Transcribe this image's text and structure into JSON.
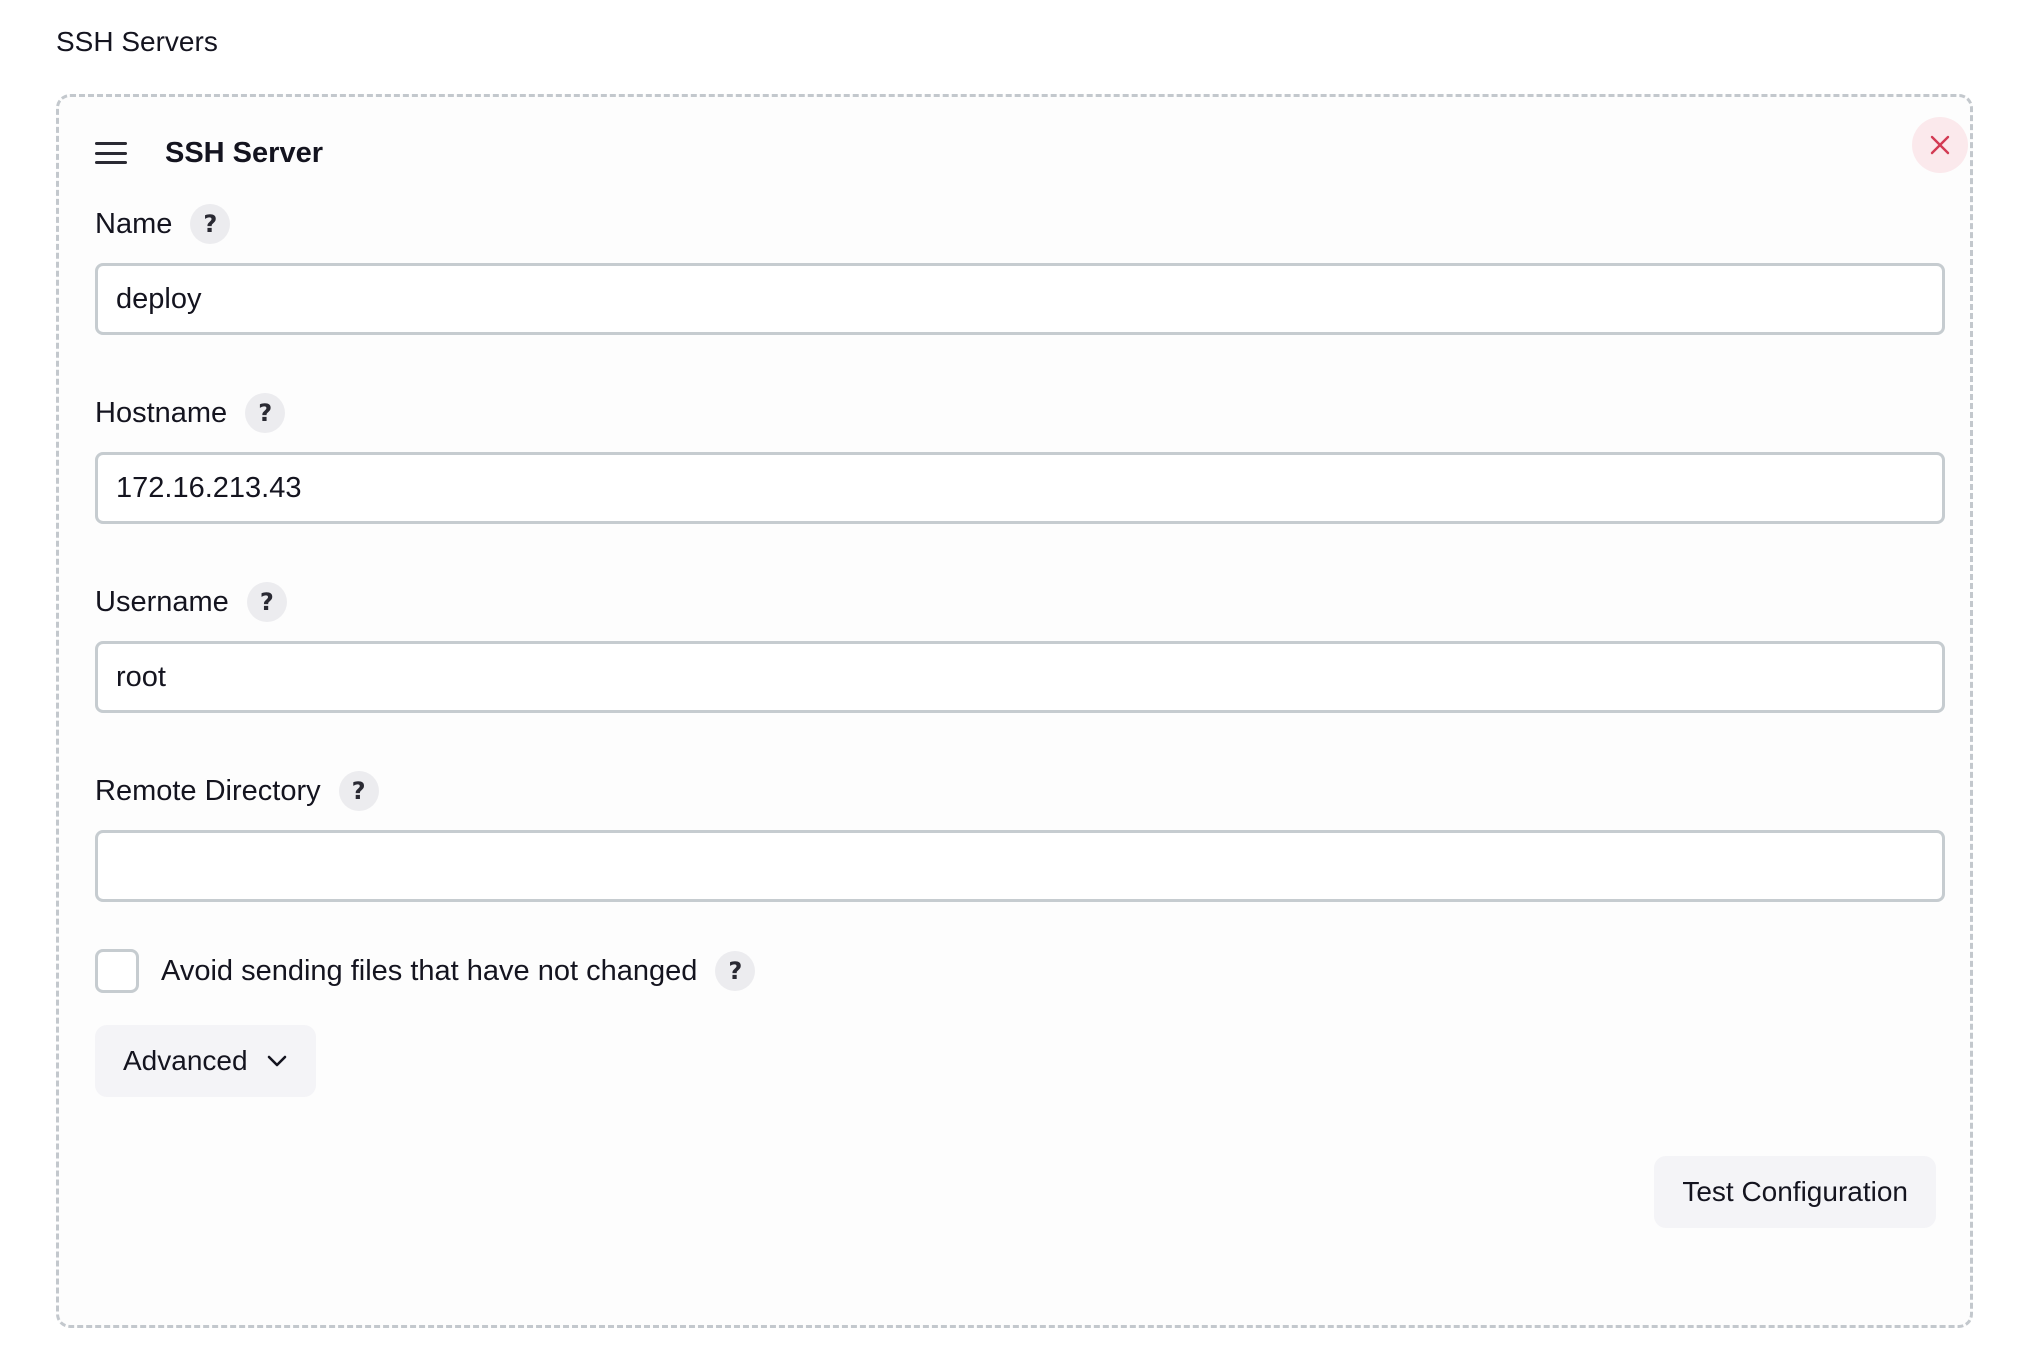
{
  "page": {
    "title": "SSH Servers"
  },
  "server_card": {
    "title": "SSH Server",
    "drag_handle_icon": "hamburger-menu-icon",
    "close_icon": "close-x-icon",
    "close_icon_color": "#d33b54",
    "fields": {
      "name": {
        "label": "Name",
        "value": "deploy",
        "help": "?"
      },
      "hostname": {
        "label": "Hostname",
        "value": "172.16.213.43",
        "help": "?"
      },
      "username": {
        "label": "Username",
        "value": "root",
        "help": "?"
      },
      "remote_directory": {
        "label": "Remote Directory",
        "value": "",
        "help": "?"
      }
    },
    "avoid_sending": {
      "label": "Avoid sending files that have not changed",
      "checked": false,
      "help": "?"
    },
    "advanced_button": {
      "label": "Advanced",
      "icon": "chevron-down-icon"
    },
    "test_button": {
      "label": "Test Configuration"
    }
  }
}
